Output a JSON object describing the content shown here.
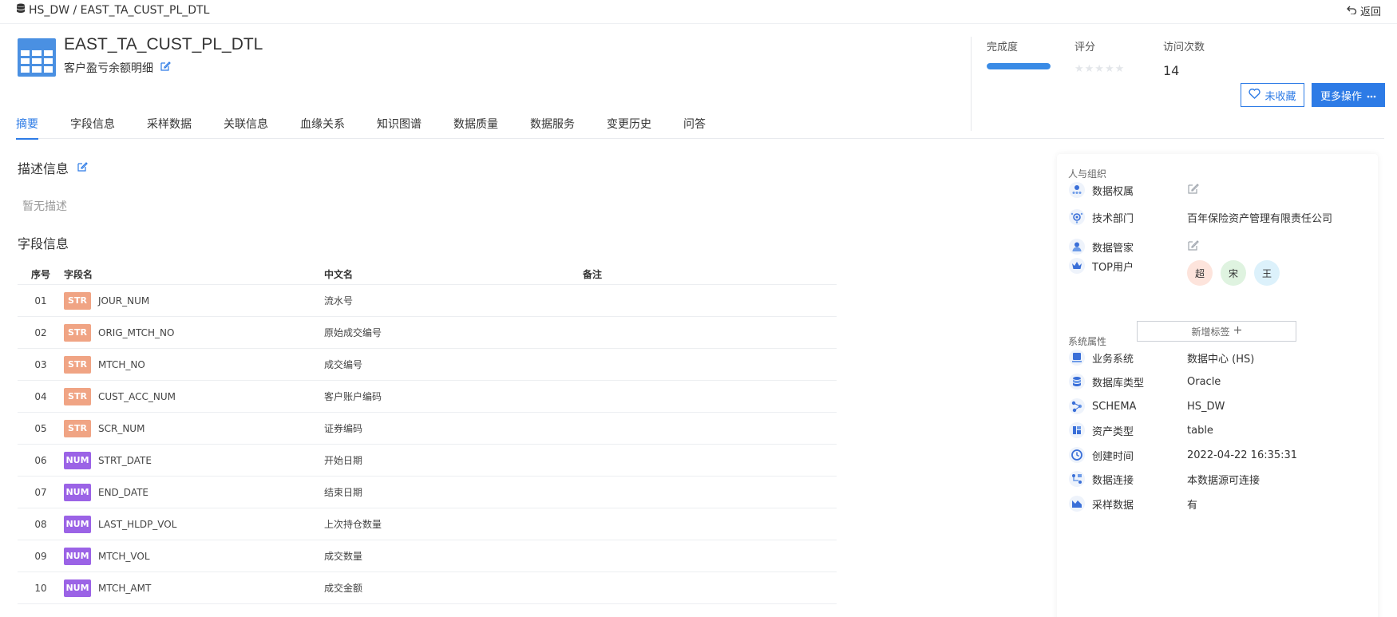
{
  "breadcrumb": {
    "text": "HS_DW / EAST_TA_CUST_PL_DTL"
  },
  "back": {
    "label": "返回"
  },
  "header": {
    "title": "EAST_TA_CUST_PL_DTL",
    "subtitle": "客户盈亏余额明细"
  },
  "stats": {
    "completeness_label": "完成度",
    "completeness_value": 1.0,
    "rating_label": "评分",
    "rating_stars": "★★★★★",
    "visits_label": "访问次数",
    "visits_value": "14"
  },
  "actions": {
    "favorite_label": "未收藏",
    "more_label": "更多操作"
  },
  "tabs": [
    {
      "label": "摘要",
      "active": true
    },
    {
      "label": "字段信息"
    },
    {
      "label": "采样数据"
    },
    {
      "label": "关联信息"
    },
    {
      "label": "血缘关系"
    },
    {
      "label": "知识图谱"
    },
    {
      "label": "数据质量"
    },
    {
      "label": "数据服务"
    },
    {
      "label": "变更历史"
    },
    {
      "label": "问答"
    }
  ],
  "description": {
    "title": "描述信息",
    "empty_text": "暂无描述"
  },
  "fields": {
    "title": "字段信息",
    "columns": {
      "no": "序号",
      "name": "字段名",
      "cn": "中文名",
      "note": "备注"
    },
    "rows": [
      {
        "no": "01",
        "type": "STR",
        "name": "JOUR_NUM",
        "cn": "流水号",
        "note": ""
      },
      {
        "no": "02",
        "type": "STR",
        "name": "ORIG_MTCH_NO",
        "cn": "原始成交编号",
        "note": ""
      },
      {
        "no": "03",
        "type": "STR",
        "name": "MTCH_NO",
        "cn": "成交编号",
        "note": ""
      },
      {
        "no": "04",
        "type": "STR",
        "name": "CUST_ACC_NUM",
        "cn": "客户账户编码",
        "note": ""
      },
      {
        "no": "05",
        "type": "STR",
        "name": "SCR_NUM",
        "cn": "证券编码",
        "note": ""
      },
      {
        "no": "06",
        "type": "NUM",
        "name": "STRT_DATE",
        "cn": "开始日期",
        "note": ""
      },
      {
        "no": "07",
        "type": "NUM",
        "name": "END_DATE",
        "cn": "结束日期",
        "note": ""
      },
      {
        "no": "08",
        "type": "NUM",
        "name": "LAST_HLDP_VOL",
        "cn": "上次持仓数量",
        "note": ""
      },
      {
        "no": "09",
        "type": "NUM",
        "name": "MTCH_VOL",
        "cn": "成交数量",
        "note": ""
      },
      {
        "no": "10",
        "type": "NUM",
        "name": "MTCH_AMT",
        "cn": "成交金额",
        "note": ""
      }
    ]
  },
  "people": {
    "title": "人与组织",
    "data_owner_label": "数据权属",
    "tech_dept_label": "技术部门",
    "tech_dept_value": "百年保险资产管理有限责任公司",
    "data_steward_label": "数据管家",
    "top_users_label": "TOP用户",
    "top_users": [
      "超",
      "宋",
      "王"
    ],
    "add_tag_label": "新增标签"
  },
  "system": {
    "title": "系统属性",
    "items": [
      {
        "label": "业务系统",
        "value": "数据中心 (HS)",
        "icon": "system-icon"
      },
      {
        "label": "数据库类型",
        "value": "Oracle",
        "icon": "database-icon"
      },
      {
        "label": "SCHEMA",
        "value": "HS_DW",
        "icon": "schema-icon"
      },
      {
        "label": "资产类型",
        "value": "table",
        "icon": "asset-type-icon"
      },
      {
        "label": "创建时间",
        "value": "2022-04-22 16:35:31",
        "icon": "clock-icon"
      },
      {
        "label": "数据连接",
        "value": "本数据源可连接",
        "icon": "connection-icon"
      },
      {
        "label": "采样数据",
        "value": "有",
        "icon": "sample-icon"
      }
    ]
  },
  "colors": {
    "accent": "#2d7be6",
    "str_badge": "#f0a484",
    "num_badge": "#9b63e6",
    "avatar_1": "#fde4dc",
    "avatar_2": "#dff3e0",
    "avatar_3": "#dcf1fb"
  }
}
